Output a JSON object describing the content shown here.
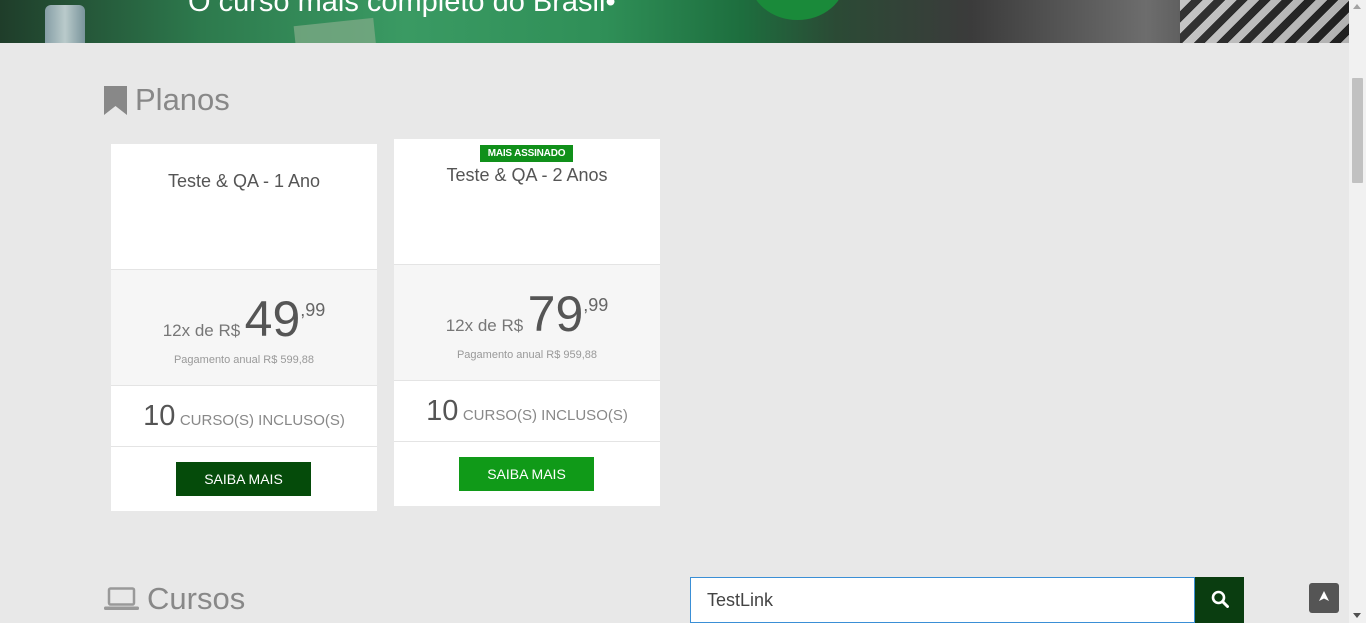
{
  "hero": {
    "title": "O curso mais completo do Brasil"
  },
  "planos_section": {
    "title": "Planos"
  },
  "plans": [
    {
      "name": "Teste & QA - 1 Ano",
      "badge": "",
      "price_prefix": "12x de R$",
      "price_int": "49",
      "price_cents": ",99",
      "annual": "Pagamento anual R$ 599,88",
      "courses_count": "10",
      "courses_label": "CURSO(S) INCLUSO(S)",
      "button": "SAIBA MAIS",
      "button_color": "#054b0a"
    },
    {
      "name": "Teste & QA - 2 Anos",
      "badge": "MAIS ASSINADO",
      "price_prefix": "12x de R$",
      "price_int": "79",
      "price_cents": ",99",
      "annual": "Pagamento anual R$ 959,88",
      "courses_count": "10",
      "courses_label": "CURSO(S) INCLUSO(S)",
      "button": "SAIBA MAIS",
      "button_color": "#109a18"
    }
  ],
  "cursos_section": {
    "title": "Cursos"
  },
  "search": {
    "value": "TestLink",
    "icon": "search-icon"
  },
  "colors": {
    "accent": "#109a18",
    "dark_green": "#054b0a",
    "badge": "#10901a"
  }
}
